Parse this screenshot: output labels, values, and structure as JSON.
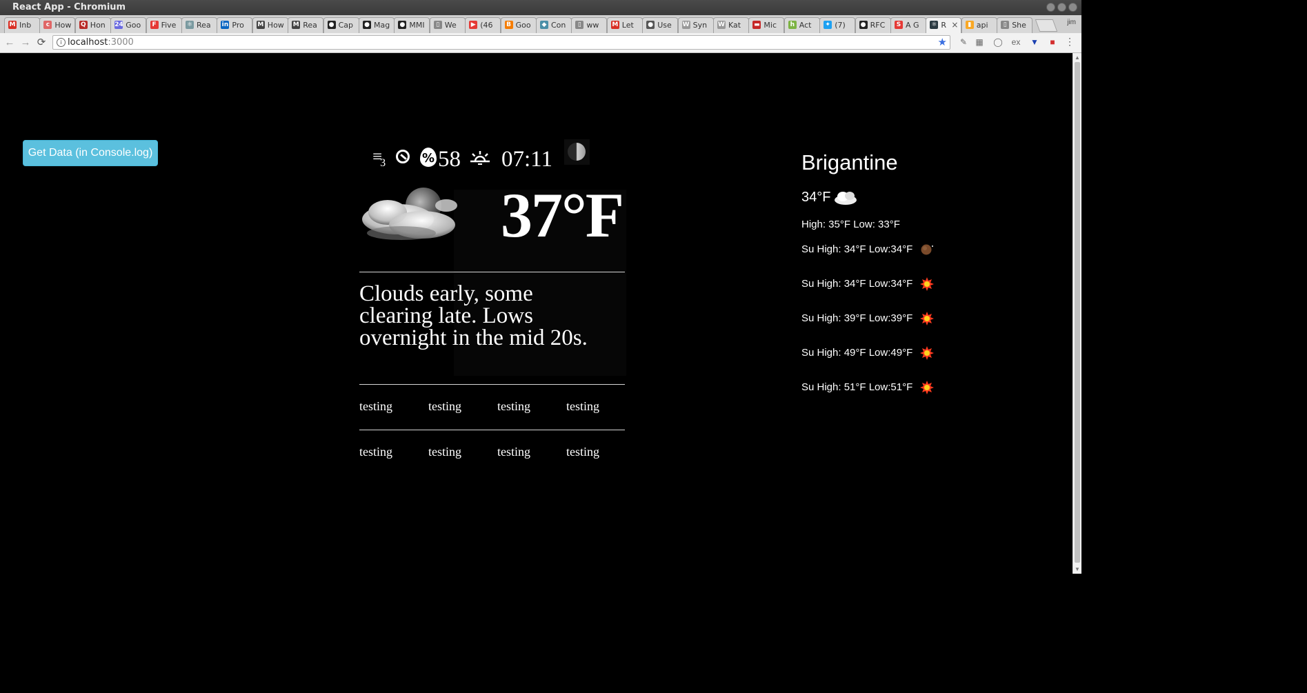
{
  "window": {
    "title": "React App - Chromium"
  },
  "tabs": [
    {
      "label": "Inb",
      "fav": "M",
      "color": "#d93025"
    },
    {
      "label": "How",
      "fav": "c",
      "color": "#e06666"
    },
    {
      "label": "Hon",
      "fav": "Q",
      "color": "#b92b27"
    },
    {
      "label": "Goo",
      "fav": "24",
      "color": "#6a6ae0"
    },
    {
      "label": "Five",
      "fav": "F",
      "color": "#e53935"
    },
    {
      "label": "Rea",
      "fav": "⚛",
      "color": "#7a9aa0"
    },
    {
      "label": "Pro",
      "fav": "in",
      "color": "#0a66c2"
    },
    {
      "label": "How",
      "fav": "M",
      "color": "#444444"
    },
    {
      "label": "Rea",
      "fav": "M",
      "color": "#444444"
    },
    {
      "label": "Cap",
      "fav": "●",
      "color": "#222222"
    },
    {
      "label": "Mag",
      "fav": "●",
      "color": "#222222"
    },
    {
      "label": "MMI",
      "fav": "●",
      "color": "#222222"
    },
    {
      "label": "We",
      "fav": "▯",
      "color": "#888888"
    },
    {
      "label": "(46",
      "fav": "▶",
      "color": "#e53935"
    },
    {
      "label": "Goo",
      "fav": "B",
      "color": "#f57c00"
    },
    {
      "label": "Con",
      "fav": "◆",
      "color": "#4a8fa8"
    },
    {
      "label": "ww",
      "fav": "▯",
      "color": "#888888"
    },
    {
      "label": "Let",
      "fav": "M",
      "color": "#d93025"
    },
    {
      "label": "Use",
      "fav": "●",
      "color": "#555555"
    },
    {
      "label": "Syn",
      "fav": "W",
      "color": "#999999"
    },
    {
      "label": "Kat",
      "fav": "W",
      "color": "#999999"
    },
    {
      "label": "Mic",
      "fav": "▬",
      "color": "#c62828"
    },
    {
      "label": "Act",
      "fav": "h",
      "color": "#7cb342"
    },
    {
      "label": "(7)",
      "fav": "✦",
      "color": "#1da1f2"
    },
    {
      "label": "RFC",
      "fav": "●",
      "color": "#222222"
    },
    {
      "label": "A G",
      "fav": "S",
      "color": "#e53935"
    },
    {
      "label": "R",
      "fav": "⚛",
      "color": "#2b3a42",
      "active": true,
      "close": "×"
    },
    {
      "label": "api",
      "fav": "▮",
      "color": "#f9a825"
    },
    {
      "label": "She",
      "fav": "▯",
      "color": "#888888"
    }
  ],
  "toolbar": {
    "back": "←",
    "forward": "→",
    "reload": "⟳",
    "url_host": "localhost",
    "url_port": ":3000",
    "info_icon": "i",
    "star": "★",
    "menu": "⋮"
  },
  "app": {
    "get_data_label": "Get Data (in Console.log)",
    "stats": {
      "humidity_symbol": "%",
      "humidity_value": "58",
      "sunrise_time": "07:11",
      "wind_beaufort": "3"
    },
    "temperature": "37°F",
    "summary": "Clouds early, some clearing late. Lows overnight in the mid 20s.",
    "grid": [
      [
        "testing",
        "testing",
        "testing",
        "testing"
      ],
      [
        "testing",
        "testing",
        "testing",
        "testing"
      ]
    ],
    "sidebar": {
      "city": "Brigantine",
      "current_temp": "34°F",
      "hilo": "High: 35°F Low: 33°F",
      "forecast": [
        {
          "text": "Su High: 34°F Low:34°F",
          "icon": "moon-icon"
        },
        {
          "text": "Su High: 34°F Low:34°F",
          "icon": "sun-icon"
        },
        {
          "text": "Su High: 39°F Low:39°F",
          "icon": "sun-icon"
        },
        {
          "text": "Su High: 49°F Low:49°F",
          "icon": "sun-icon"
        },
        {
          "text": "Su High: 51°F Low:51°F",
          "icon": "sun-icon"
        }
      ]
    },
    "colors": {
      "button": "#5bc0de",
      "background": "#000000",
      "text": "#ffffff",
      "sun": "#ff3b1f"
    }
  }
}
